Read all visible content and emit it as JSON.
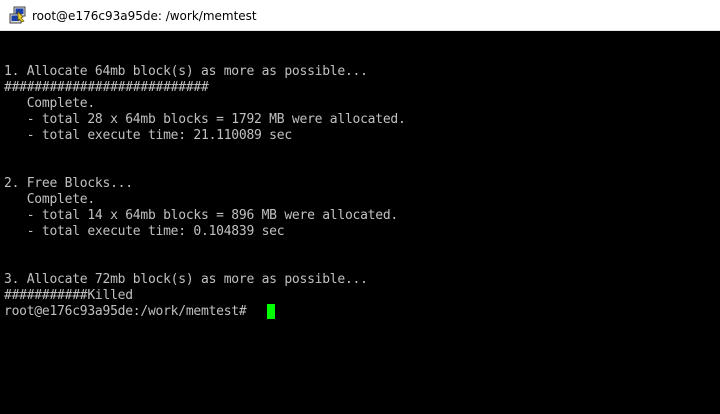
{
  "window": {
    "title": "root@e176c93a95de: /work/memtest",
    "icon": "putty-icon"
  },
  "terminal": {
    "lines": [
      "",
      "",
      "1. Allocate 64mb block(s) as more as possible...",
      "###########################",
      "   Complete.",
      "   - total 28 x 64mb blocks = 1792 MB were allocated.",
      "   - total execute time: 21.110089 sec",
      "",
      "",
      "",
      "2. Free Blocks...",
      "   Complete.",
      "   - total 14 x 64mb blocks = 896 MB were allocated.",
      "   - total execute time: 0.104839 sec",
      "",
      "",
      "3. Allocate 72mb block(s) as more as possible...",
      "###########Killed",
      "root@e176c93a95de:/work/memtest# "
    ],
    "colors": {
      "background": "#000000",
      "text": "#c0c0c0",
      "cursor": "#00ff00"
    }
  }
}
